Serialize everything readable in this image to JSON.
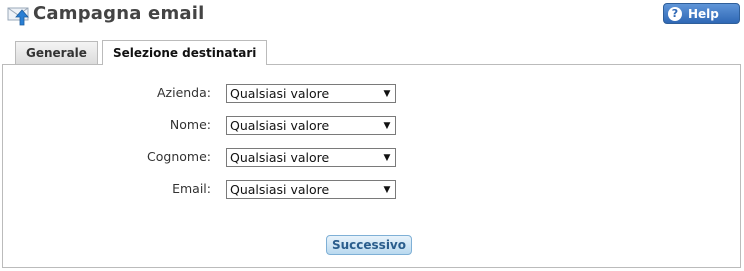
{
  "header": {
    "title": "Campagna email",
    "app_icon": "mail-upload-icon",
    "help_label": "Help",
    "help_icon": "question-icon",
    "help_color": "#2f68b5"
  },
  "tabs": [
    {
      "label": "Generale",
      "active": false
    },
    {
      "label": "Selezione destinatari",
      "active": true
    }
  ],
  "filters": [
    {
      "label": "Azienda:",
      "value": "Qualsiasi valore"
    },
    {
      "label": "Nome:",
      "value": "Qualsiasi valore"
    },
    {
      "label": "Cognome:",
      "value": "Qualsiasi valore"
    },
    {
      "label": "Email:",
      "value": "Qualsiasi valore"
    }
  ],
  "actions": {
    "next_label": "Successivo"
  }
}
